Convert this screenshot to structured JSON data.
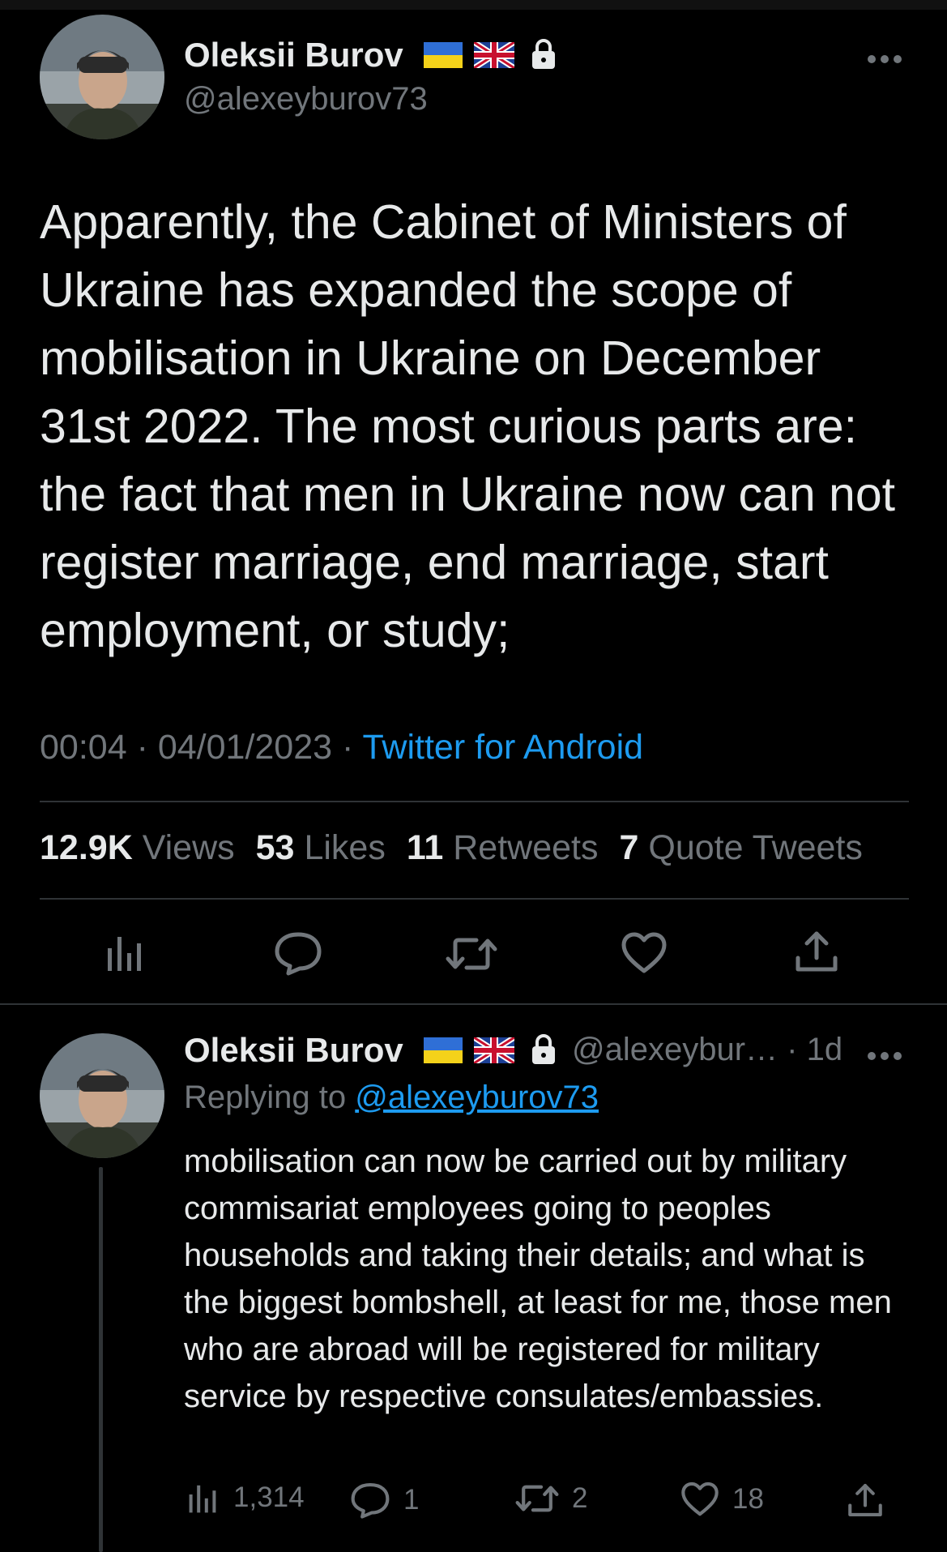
{
  "tweet": {
    "author_name": "Oleksii Burov",
    "author_handle": "@alexeyburov73",
    "text": "Apparently, the Cabinet of Ministers of Ukraine has expanded the scope of mobilisation in Ukraine on December 31st 2022. The most curious parts are: the fact that men in Ukraine now can not register marriage, end marriage, start employment, or study;",
    "time": "00:04",
    "date": "04/01/2023",
    "separator": "·",
    "source": "Twitter for Android",
    "stats": {
      "views_count": "12.9K",
      "views_label": "Views",
      "likes_count": "53",
      "likes_label": "Likes",
      "retweets_count": "11",
      "retweets_label": "Retweets",
      "quotes_count": "7",
      "quotes_label": "Quote Tweets"
    },
    "actions": [
      "analytics-icon",
      "reply-icon",
      "retweet-icon",
      "like-icon",
      "share-icon"
    ]
  },
  "reply": {
    "author_name": "Oleksii Burov",
    "author_handle": "@alexeybur…",
    "age": "· 1d",
    "replying_prefix": "Replying to",
    "replying_to": "@alexeyburov73",
    "text": "mobilisation can now be carried out by military commisariat employees going to peoples households and taking their details; and what is the biggest bombshell, at least for me, those men who are abroad will be registered for military service by respective consulates/embassies.",
    "views": "1,314",
    "replies": "1",
    "retweets": "2",
    "likes": "18"
  },
  "colors": {
    "background": "#000000",
    "text": "#e7e9ea",
    "secondary": "#71767b",
    "link": "#1d9bf0"
  }
}
